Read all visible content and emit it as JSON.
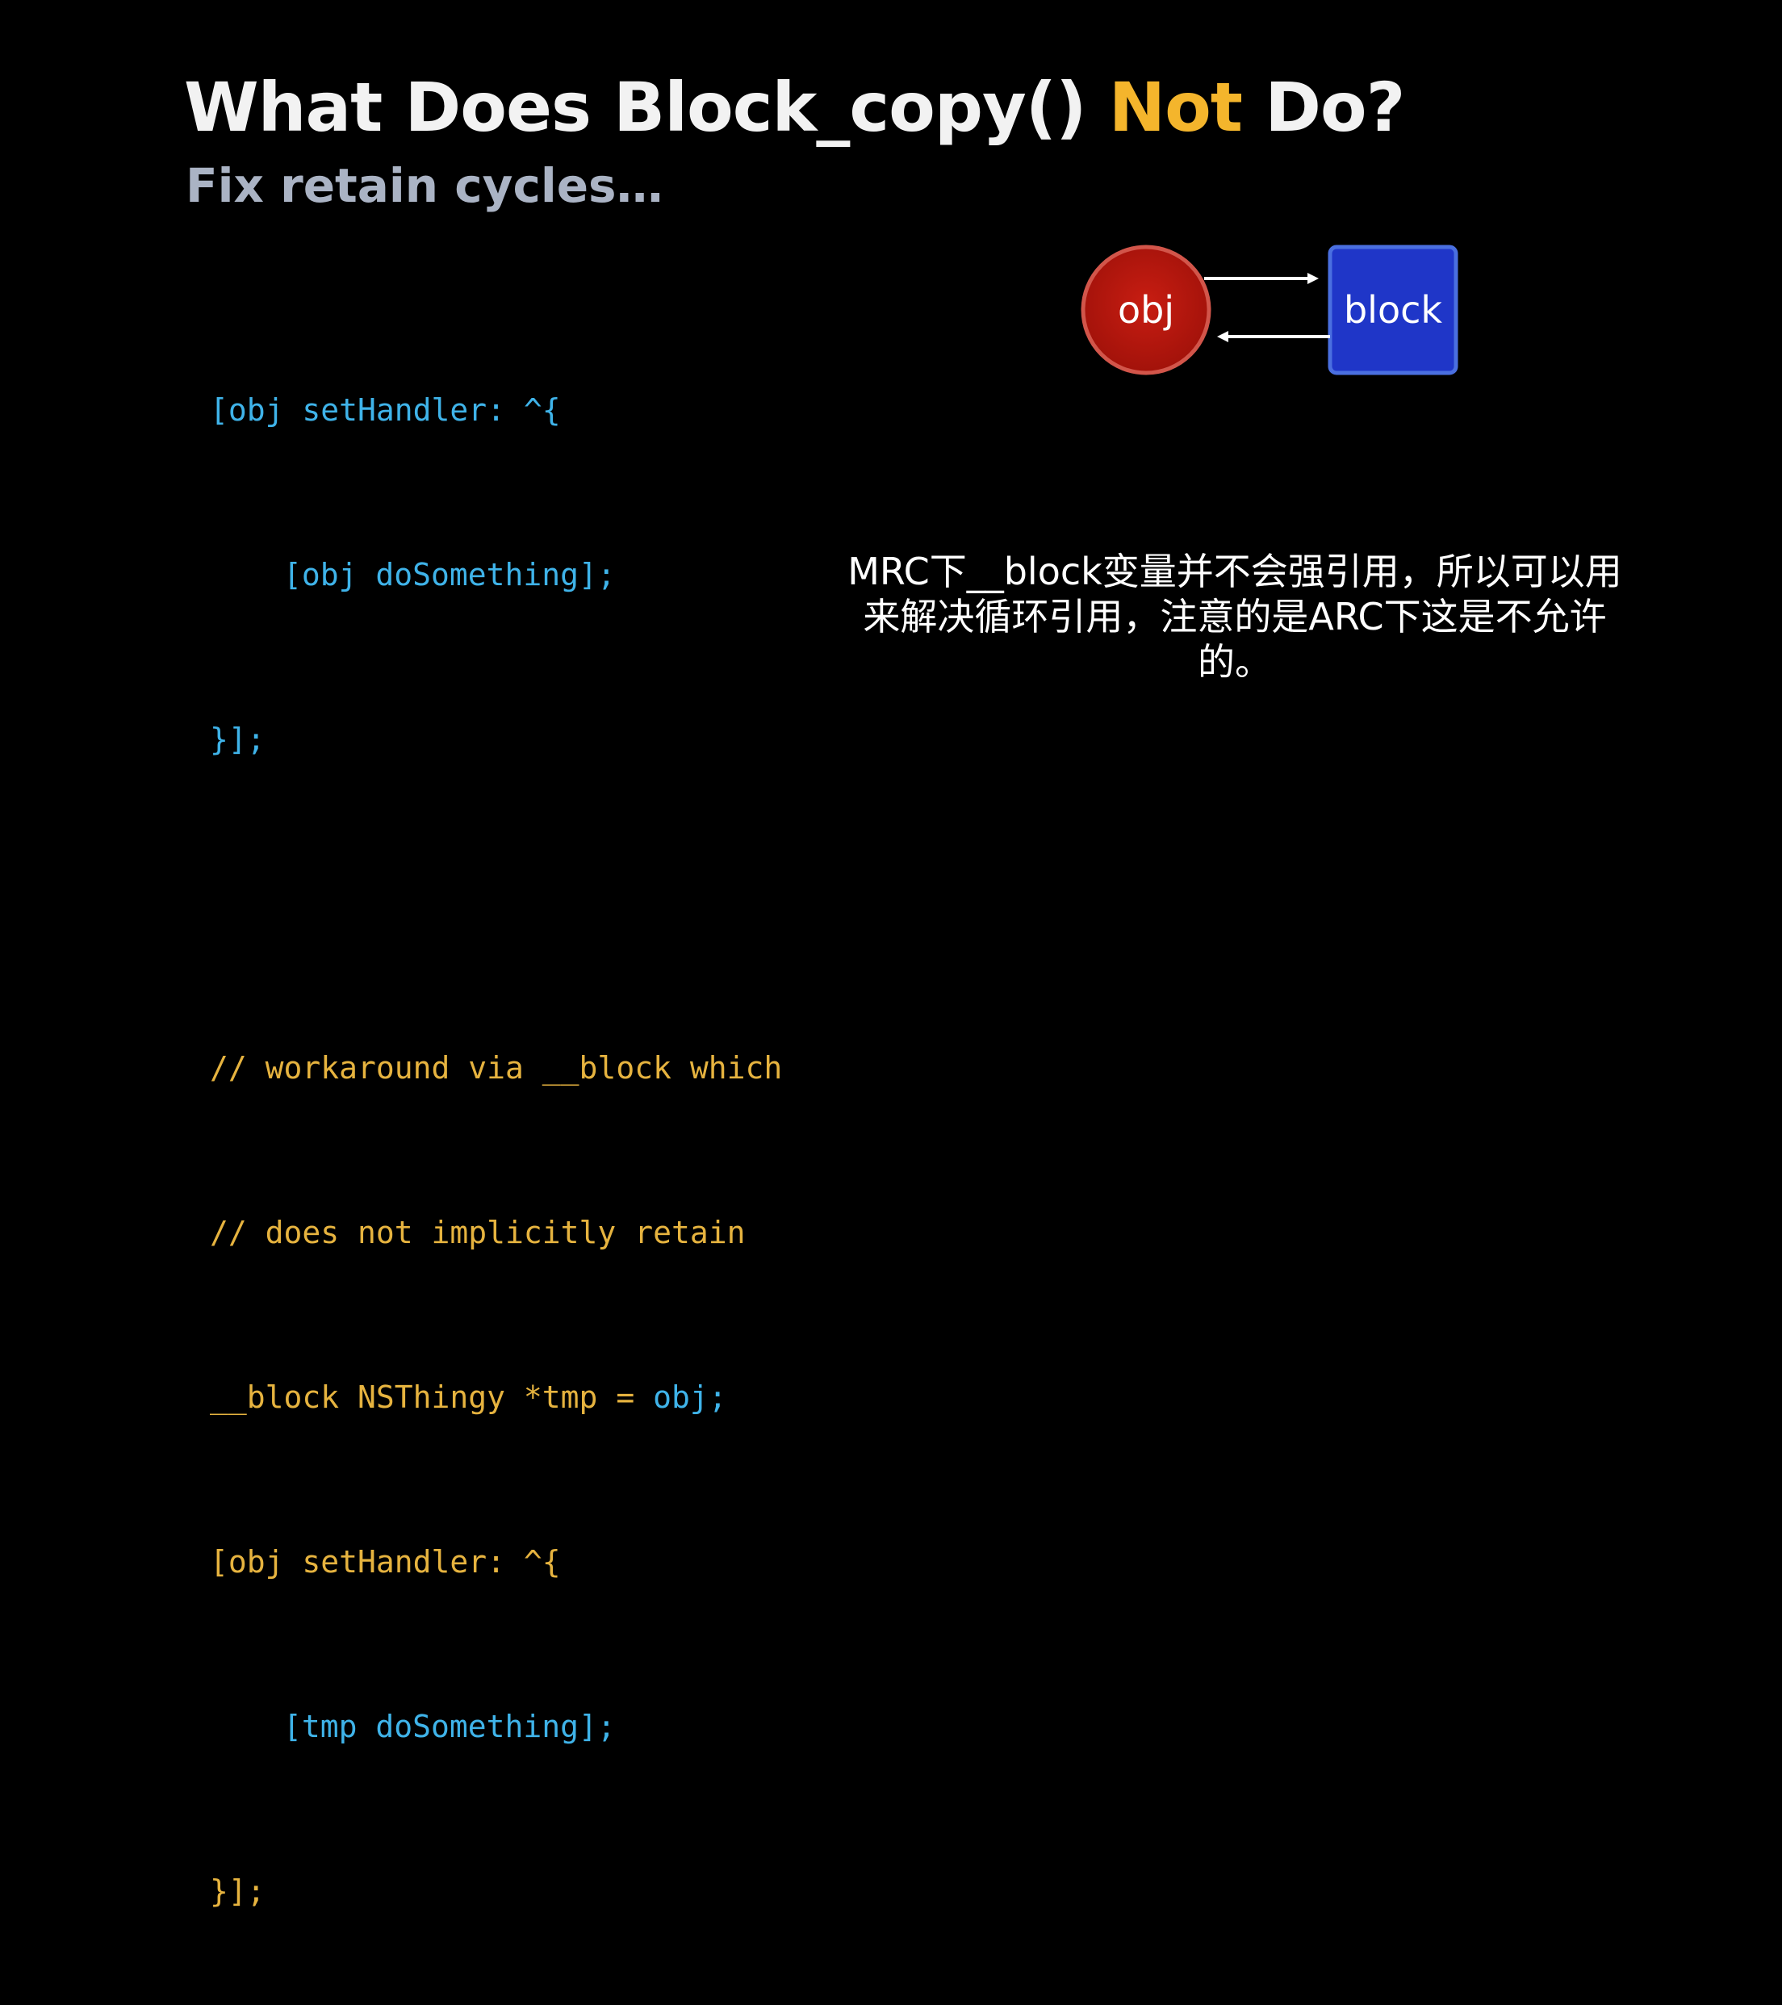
{
  "slide": {
    "title_part1": "What Does Block_copy() ",
    "title_highlight": "Not",
    "title_part2": " Do?",
    "subtitle": "Fix retain cycles…"
  },
  "code": {
    "block1": [
      "[obj setHandler: ^{",
      "[obj doSomething];",
      "}];"
    ],
    "block2": [
      "// workaround via __block which",
      "// does not implicitly retain",
      "__block NSThingy *tmp = ",
      "obj;",
      "[obj setHandler: ^{",
      "[tmp doSomething];",
      "}];"
    ]
  },
  "diagram": {
    "left_node": "obj",
    "right_node": "block",
    "left_color": "#c0170f",
    "right_color": "#1f36c8"
  },
  "annotation": "MRC下__block变量并不会强引用，所以可以用来解决循环引用，注意的是ARC下这是不允许的。",
  "colors": {
    "background": "#000000",
    "highlight": "#f4b52c",
    "code_blue": "#3fb3e9",
    "code_yellow": "#e6b33f"
  }
}
